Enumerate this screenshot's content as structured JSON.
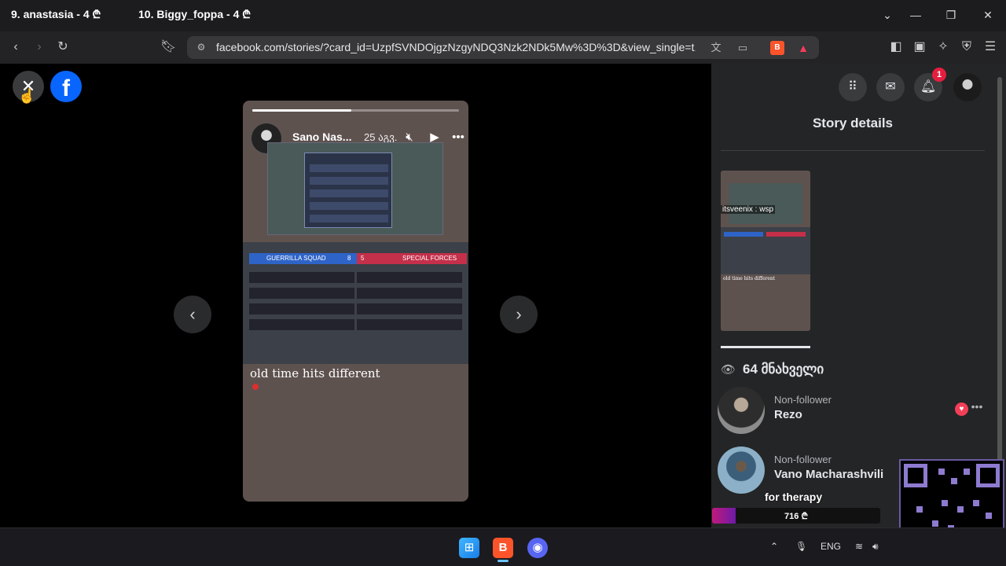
{
  "browser": {
    "tabs": [
      {
        "label": "9. anastasia - 4 ₾"
      },
      {
        "label": "10. Biggy_foppa - 4 ₾"
      }
    ],
    "address_bar": {
      "url": "facebook.com/stories/?card_id=UzpfSVNDOjgzNzgyNDQ3Nzk2NDk5Mw%3D%3D&view_single=t..."
    },
    "icons": {
      "back": "back-arrow-icon",
      "forward": "forward-arrow-icon",
      "reload": "reload-icon",
      "bookmark": "bookmark-icon",
      "site_settings": "tune-icon",
      "translate": "translate-icon",
      "cast": "cast-icon",
      "brave_shields": "brave-shield-icon",
      "rewards": "brave-rewards-icon",
      "sidebar": "sidebar-icon",
      "wallet": "wallet-icon",
      "leo": "leo-icon",
      "vpn": "vpn-icon",
      "menu": "hamburger-menu-icon"
    }
  },
  "story": {
    "author_name": "Sano Nas...",
    "posted_time": "25 აგვ.",
    "progress": 0.48,
    "caption": "old time hits different",
    "scoreboard": {
      "team_a": "GUERRILLA SQUAD",
      "team_a_score": "8",
      "team_b": "SPECIAL FORCES",
      "team_b_score": "5"
    }
  },
  "panel": {
    "title": "Story details",
    "notification_count": "1",
    "thumbnail_sticker": "itsveenix : wsp",
    "thumbnail_caption": "old time hits different",
    "viewers_count": "64 მნახველი",
    "viewers": [
      {
        "status": "Non-follower",
        "name": "Rezo"
      },
      {
        "status": "Non-follower",
        "name": "Vano Macharashvili"
      }
    ]
  },
  "overlay": {
    "goal_text": "for therapy",
    "goal_amount": "716 ₾",
    "goal_progress": 0.14
  },
  "taskbar": {
    "language": "ENG"
  },
  "colors": {
    "facebook_blue": "#0866ff",
    "notification_red": "#e41e3f",
    "panel_bg": "#242526",
    "brave_orange": "#fb542b"
  }
}
